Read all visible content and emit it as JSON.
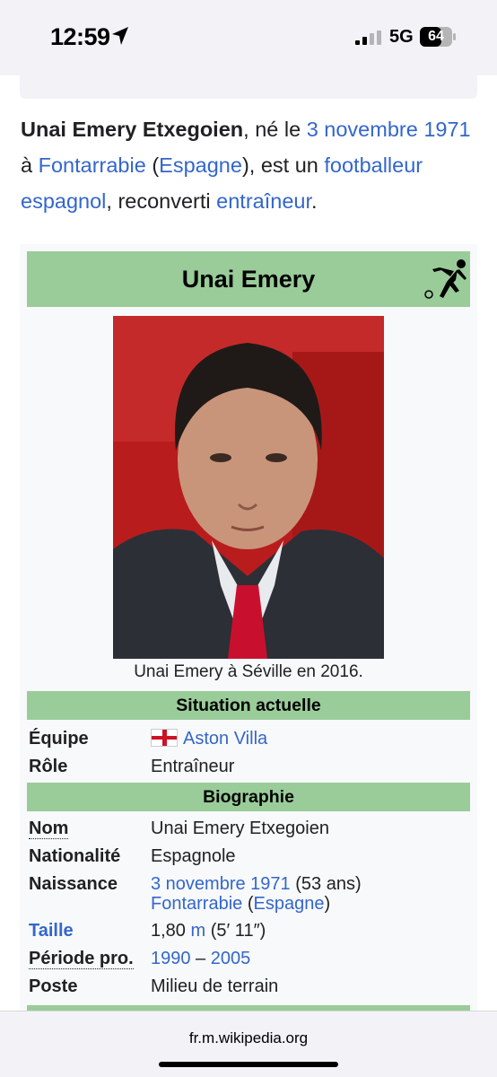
{
  "status_bar": {
    "time": "12:59",
    "network": "5G",
    "battery": "64"
  },
  "intro": {
    "name_bold": "Unai Emery Etxegoien",
    "t1": ", né le ",
    "birth_date_link": "3 novembre 1971",
    "t2": " à ",
    "birthplace_link": "Fontarrabie",
    "t3": " (",
    "country_link": "Espagne",
    "t4": "), est un ",
    "footballer_link": "footballeur espagnol",
    "t5": ", reconverti ",
    "coach_link": "entraîneur",
    "t6": "."
  },
  "infobox": {
    "title": "Unai Emery",
    "caption": "Unai Emery à Séville en 2016.",
    "section_current": "Situation actuelle",
    "team_label": "Équipe",
    "team_value": "Aston Villa",
    "role_label": "Rôle",
    "role_value": "Entraîneur",
    "section_bio": "Biographie",
    "name_label": "Nom",
    "name_value": "Unai Emery Etxegoien",
    "nationality_label": "Nationalité",
    "nationality_value": "Espagnole",
    "birth_label": "Naissance",
    "birth_date": "3 novembre 1971",
    "birth_age": " (53 ans)",
    "birth_place": "Fontarrabie",
    "birth_country": "Espagne",
    "height_label": "Taille",
    "height_value_pre": "1,80 ",
    "height_unit": "m",
    "height_value_post": " (5′ 11″)",
    "period_label": "Période pro.",
    "period_start": "1990",
    "period_sep": " – ",
    "period_end": "2005",
    "position_label": "Poste",
    "position_value": "Milieu de terrain"
  },
  "browser": {
    "url": "fr.m.wikipedia.org"
  },
  "colors": {
    "link": "#3366cc",
    "infobox_header": "#99cc99",
    "infobox_bg": "#f8f9fa"
  },
  "icons": [
    "location-arrow-icon",
    "cellular-signal-icon",
    "battery-icon",
    "football-player-icon"
  ]
}
